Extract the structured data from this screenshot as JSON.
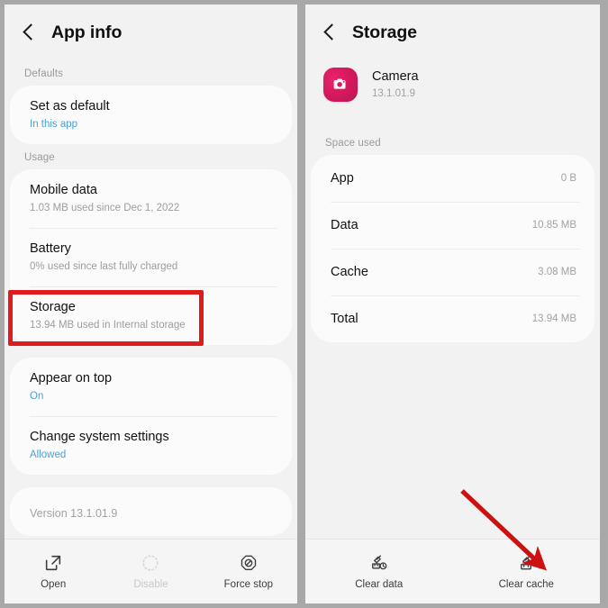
{
  "left_panel": {
    "header": {
      "title": "App info",
      "back_icon": "back-chevron-icon"
    },
    "sections": [
      {
        "label": "Defaults",
        "rows": [
          {
            "title": "Set as default",
            "sub": "In this app",
            "sub_accent": true
          }
        ]
      },
      {
        "label": "Usage",
        "rows": [
          {
            "title": "Mobile data",
            "sub": "1.03 MB used since Dec 1, 2022",
            "sub_accent": false
          },
          {
            "title": "Battery",
            "sub": "0% used since last fully charged",
            "sub_accent": false
          },
          {
            "title": "Storage",
            "sub": "13.94 MB used in Internal storage",
            "sub_accent": false
          }
        ]
      },
      {
        "label": "",
        "rows": [
          {
            "title": "Appear on top",
            "sub": "On",
            "sub_accent": true
          },
          {
            "title": "Change system settings",
            "sub": "Allowed",
            "sub_accent": true
          }
        ]
      }
    ],
    "version_text": "Version 13.1.01.9",
    "actions": [
      {
        "label": "Open",
        "icon": "open-external-icon",
        "disabled": false
      },
      {
        "label": "Disable",
        "icon": "disable-dotted-circle-icon",
        "disabled": true
      },
      {
        "label": "Force stop",
        "icon": "force-stop-octagon-icon",
        "disabled": false
      }
    ]
  },
  "right_panel": {
    "header": {
      "title": "Storage",
      "back_icon": "back-chevron-icon"
    },
    "app": {
      "name": "Camera",
      "version": "13.1.01.9",
      "icon": "camera-app-icon"
    },
    "section_label": "Space used",
    "rows": [
      {
        "label": "App",
        "value": "0 B"
      },
      {
        "label": "Data",
        "value": "10.85 MB"
      },
      {
        "label": "Cache",
        "value": "3.08 MB"
      },
      {
        "label": "Total",
        "value": "13.94 MB"
      }
    ],
    "actions": [
      {
        "label": "Clear data",
        "icon": "clear-data-broom-icon"
      },
      {
        "label": "Clear cache",
        "icon": "clear-cache-broom-icon"
      }
    ]
  },
  "annotations": {
    "highlight_color": "#e01b1b",
    "arrow_color": "#cc1111",
    "highlight_target": "Storage",
    "arrow_target": "Clear cache"
  }
}
